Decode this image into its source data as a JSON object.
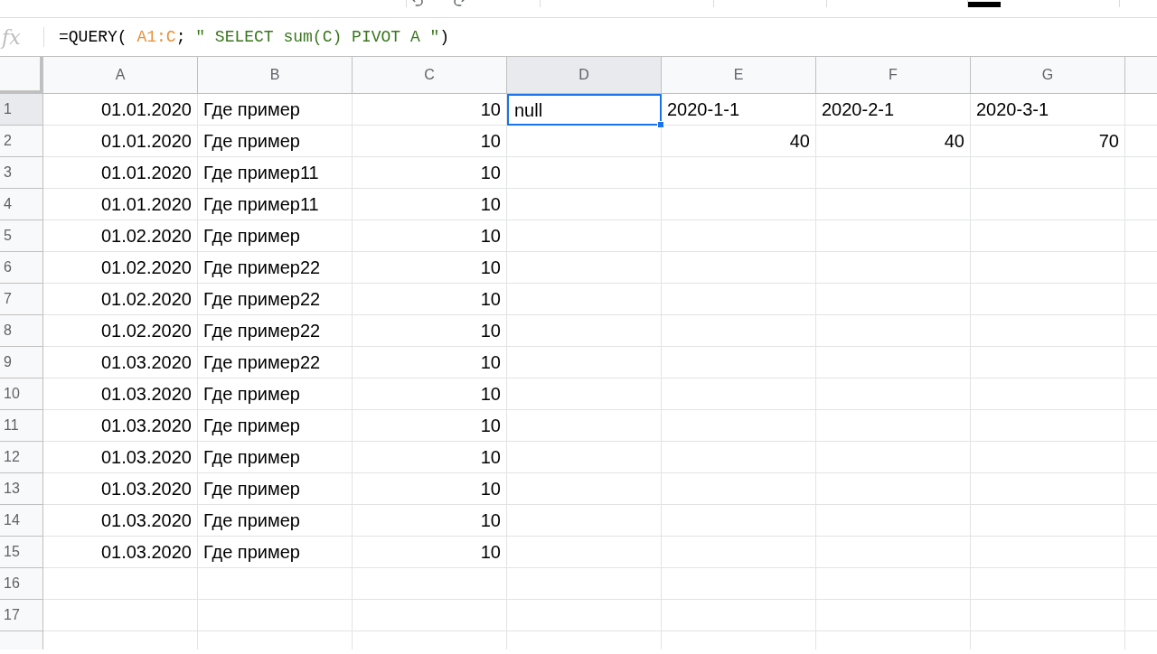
{
  "formula_bar": {
    "icon_label": "fx",
    "parts": [
      {
        "kind": "plain",
        "text": "=QUERY( "
      },
      {
        "kind": "range",
        "text": "A1:C"
      },
      {
        "kind": "plain",
        "text": "; "
      },
      {
        "kind": "string",
        "text": "\" SELECT sum(C) PIVOT A \""
      },
      {
        "kind": "plain",
        "text": ")"
      }
    ]
  },
  "columns": [
    {
      "label": "A",
      "selected": false
    },
    {
      "label": "B",
      "selected": false
    },
    {
      "label": "C",
      "selected": false
    },
    {
      "label": "D",
      "selected": true
    },
    {
      "label": "E",
      "selected": false
    },
    {
      "label": "F",
      "selected": false
    },
    {
      "label": "G",
      "selected": false
    }
  ],
  "rows": [
    {
      "label": "1",
      "selected": true,
      "cells": [
        {
          "kind": "number",
          "text": "01.01.2020"
        },
        {
          "kind": "text",
          "text": "Где пример"
        },
        {
          "kind": "number",
          "text": "10"
        },
        {
          "kind": "text",
          "text": "null"
        },
        {
          "kind": "text",
          "text": "2020-1-1"
        },
        {
          "kind": "text",
          "text": "2020-2-1"
        },
        {
          "kind": "text",
          "text": "2020-3-1"
        }
      ]
    },
    {
      "label": "2",
      "selected": false,
      "cells": [
        {
          "kind": "number",
          "text": "01.01.2020"
        },
        {
          "kind": "text",
          "text": "Где пример"
        },
        {
          "kind": "number",
          "text": "10"
        },
        {
          "kind": "empty"
        },
        {
          "kind": "number",
          "text": "40"
        },
        {
          "kind": "number",
          "text": "40"
        },
        {
          "kind": "number",
          "text": "70"
        }
      ]
    },
    {
      "label": "3",
      "selected": false,
      "cells": [
        {
          "kind": "number",
          "text": "01.01.2020"
        },
        {
          "kind": "text",
          "text": "Где пример11"
        },
        {
          "kind": "number",
          "text": "10"
        }
      ]
    },
    {
      "label": "4",
      "selected": false,
      "cells": [
        {
          "kind": "number",
          "text": "01.01.2020"
        },
        {
          "kind": "text",
          "text": "Где пример11"
        },
        {
          "kind": "number",
          "text": "10"
        }
      ]
    },
    {
      "label": "5",
      "selected": false,
      "cells": [
        {
          "kind": "number",
          "text": "01.02.2020"
        },
        {
          "kind": "text",
          "text": "Где пример"
        },
        {
          "kind": "number",
          "text": "10"
        }
      ]
    },
    {
      "label": "6",
      "selected": false,
      "cells": [
        {
          "kind": "number",
          "text": "01.02.2020"
        },
        {
          "kind": "text",
          "text": "Где пример22"
        },
        {
          "kind": "number",
          "text": "10"
        }
      ]
    },
    {
      "label": "7",
      "selected": false,
      "cells": [
        {
          "kind": "number",
          "text": "01.02.2020"
        },
        {
          "kind": "text",
          "text": "Где пример22"
        },
        {
          "kind": "number",
          "text": "10"
        }
      ]
    },
    {
      "label": "8",
      "selected": false,
      "cells": [
        {
          "kind": "number",
          "text": "01.02.2020"
        },
        {
          "kind": "text",
          "text": "Где пример22"
        },
        {
          "kind": "number",
          "text": "10"
        }
      ]
    },
    {
      "label": "9",
      "selected": false,
      "cells": [
        {
          "kind": "number",
          "text": "01.03.2020"
        },
        {
          "kind": "text",
          "text": "Где пример22"
        },
        {
          "kind": "number",
          "text": "10"
        }
      ]
    },
    {
      "label": "10",
      "selected": false,
      "cells": [
        {
          "kind": "number",
          "text": "01.03.2020"
        },
        {
          "kind": "text",
          "text": "Где пример"
        },
        {
          "kind": "number",
          "text": "10"
        }
      ]
    },
    {
      "label": "11",
      "selected": false,
      "cells": [
        {
          "kind": "number",
          "text": "01.03.2020"
        },
        {
          "kind": "text",
          "text": "Где пример"
        },
        {
          "kind": "number",
          "text": "10"
        }
      ]
    },
    {
      "label": "12",
      "selected": false,
      "cells": [
        {
          "kind": "number",
          "text": "01.03.2020"
        },
        {
          "kind": "text",
          "text": "Где пример"
        },
        {
          "kind": "number",
          "text": "10"
        }
      ]
    },
    {
      "label": "13",
      "selected": false,
      "cells": [
        {
          "kind": "number",
          "text": "01.03.2020"
        },
        {
          "kind": "text",
          "text": "Где пример"
        },
        {
          "kind": "number",
          "text": "10"
        }
      ]
    },
    {
      "label": "14",
      "selected": false,
      "cells": [
        {
          "kind": "number",
          "text": "01.03.2020"
        },
        {
          "kind": "text",
          "text": "Где пример"
        },
        {
          "kind": "number",
          "text": "10"
        }
      ]
    },
    {
      "label": "15",
      "selected": false,
      "cells": [
        {
          "kind": "number",
          "text": "01.03.2020"
        },
        {
          "kind": "text",
          "text": "Где пример"
        },
        {
          "kind": "number",
          "text": "10"
        }
      ]
    },
    {
      "label": "16",
      "selected": false,
      "cells": []
    },
    {
      "label": "17",
      "selected": false,
      "cells": []
    }
  ]
}
